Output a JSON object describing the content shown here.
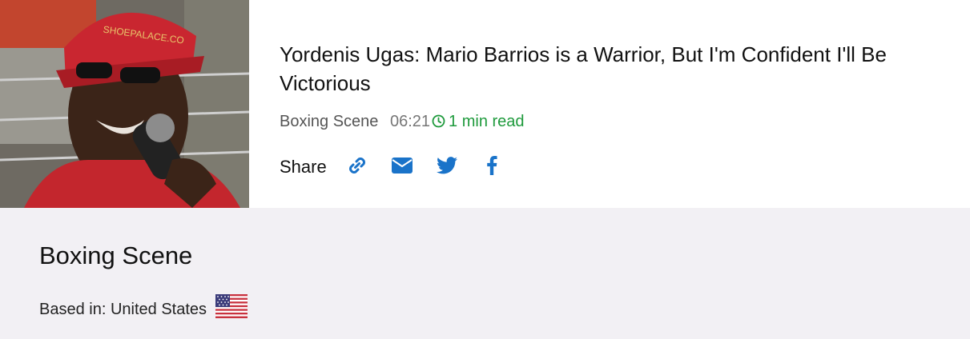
{
  "article": {
    "headline": "Yordenis Ugas: Mario Barrios is a Warrior, But I'm Confident I'll Be Victorious",
    "source": "Boxing Scene",
    "time": "06:21",
    "read_time": "1 min read",
    "image_caption_text": "SHOEPALACE.CO"
  },
  "share": {
    "label": "Share",
    "buttons": [
      {
        "name": "link-icon",
        "color": "#1a73c9"
      },
      {
        "name": "email-icon",
        "color": "#1a73c9"
      },
      {
        "name": "twitter-icon",
        "color": "#1a73c9"
      },
      {
        "name": "facebook-icon",
        "color": "#1a73c9"
      }
    ]
  },
  "publisher": {
    "name": "Boxing Scene",
    "based_in": "Based in: United States",
    "flag": "us-flag-icon"
  },
  "colors": {
    "accent_blue": "#1a73c9",
    "read_green": "#1e9a3c",
    "panel_bg": "#f2f0f4"
  }
}
